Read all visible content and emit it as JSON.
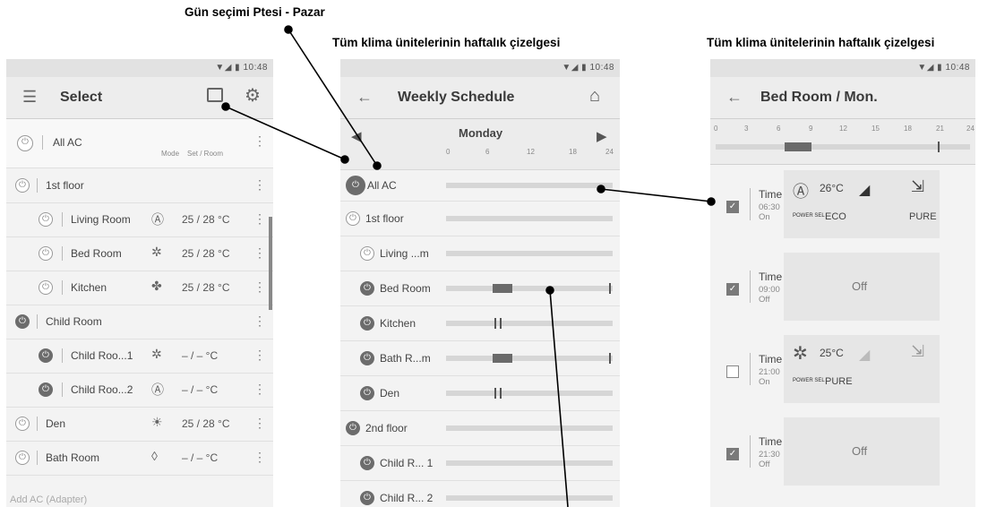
{
  "callouts": {
    "day_select": "Gün seçimi Ptesi - Pazar",
    "weekly_all": "Tüm klima ünitelerinin haftalık çizelgesi",
    "weekly_room": "Tüm klima ünitelerinin haftalık çizelgesi"
  },
  "status_time": "10:48",
  "screen1": {
    "title": "Select",
    "header": {
      "label": "All AC",
      "mode_col": "Mode",
      "set_col": "Set / Room"
    },
    "rows": [
      {
        "label": "1st floor",
        "mode_icon": "",
        "value": ""
      },
      {
        "label": "Living Room",
        "mode_icon": "Ⓐ",
        "value": "25 / 28 °C"
      },
      {
        "label": "Bed Room",
        "mode_icon": "✲",
        "value": "25 / 28 °C"
      },
      {
        "label": "Kitchen",
        "mode_icon": "✤",
        "value": "25 / 28 °C"
      },
      {
        "label": "Child Room",
        "mode_icon": "",
        "value": ""
      },
      {
        "label": "Child Roo...1",
        "mode_icon": "✲",
        "value": "– / –  °C"
      },
      {
        "label": "Child Roo...2",
        "mode_icon": "Ⓐ",
        "value": "– / –  °C"
      },
      {
        "label": "Den",
        "mode_icon": "☀",
        "value": "25 / 28 °C"
      },
      {
        "label": "Bath Room",
        "mode_icon": "◊",
        "value": "– / –  °C"
      }
    ],
    "footer": "Add AC (Adapter)"
  },
  "screen2": {
    "title": "Weekly Schedule",
    "day": "Monday",
    "hours": [
      "0",
      "6",
      "12",
      "18",
      "24"
    ],
    "rows": [
      {
        "label": "All AC"
      },
      {
        "label": "1st floor"
      },
      {
        "label": "Living ...m"
      },
      {
        "label": "Bed Room"
      },
      {
        "label": "Kitchen"
      },
      {
        "label": "Bath R...m"
      },
      {
        "label": "Den"
      },
      {
        "label": "2nd floor"
      },
      {
        "label": "Child R... 1"
      },
      {
        "label": "Child R... 2"
      }
    ]
  },
  "screen3": {
    "title": "Bed Room / Mon.",
    "hours": [
      "0",
      "3",
      "6",
      "9",
      "12",
      "15",
      "18",
      "21",
      "24"
    ],
    "timers": [
      {
        "name": "Time 1",
        "time": "06:30",
        "state": "On",
        "checked": true,
        "mode_icon": "Ⓐ",
        "temp": "26°C",
        "power": "POWER SEL",
        "extra": "ECO",
        "pure": "PURE"
      },
      {
        "name": "Time 2",
        "time": "09:00",
        "state": "Off",
        "checked": true,
        "off_label": "Off"
      },
      {
        "name": "Time 3",
        "time": "21:00",
        "state": "On",
        "checked": false,
        "mode_icon": "✲",
        "temp": "25°C",
        "power": "POWER SEL",
        "extra": "PURE",
        "pure": ""
      },
      {
        "name": "Time 4",
        "time": "21:30",
        "state": "Off",
        "checked": true,
        "off_label": "Off"
      }
    ]
  }
}
